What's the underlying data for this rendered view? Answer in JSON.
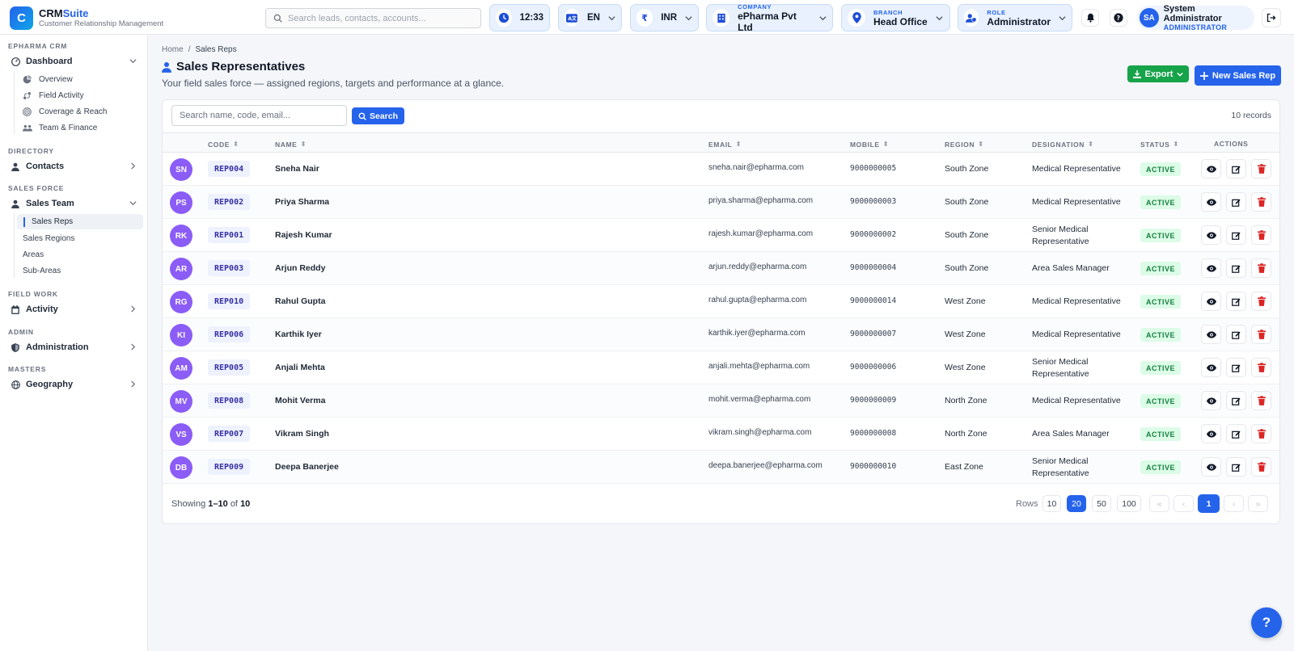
{
  "brand": {
    "logo_letter": "C",
    "name_a": "CRM",
    "name_b": "Suite",
    "subtitle": "Customer Relationship Management"
  },
  "topbar": {
    "search_placeholder": "Search leads, contacts, accounts...",
    "time": "12:33",
    "language": "EN",
    "currency_symbol": "₹",
    "currency": "INR",
    "company": {
      "label": "COMPANY",
      "value": "ePharma Pvt Ltd"
    },
    "branch": {
      "label": "BRANCH",
      "value": "Head Office"
    },
    "role": {
      "label": "ROLE",
      "value": "Administrator"
    },
    "user": {
      "initials": "SA",
      "name": "System Administrator",
      "role": "ADMINISTRATOR"
    }
  },
  "sidebar": {
    "app_section": "EPHARMA CRM",
    "dashboard": {
      "label": "Dashboard",
      "items": [
        "Overview",
        "Field Activity",
        "Coverage & Reach",
        "Team & Finance"
      ]
    },
    "directory_section": "DIRECTORY",
    "contacts": "Contacts",
    "salesforce_section": "SALES FORCE",
    "sales_team": {
      "label": "Sales Team",
      "items": [
        "Sales Reps",
        "Sales Regions",
        "Areas",
        "Sub-Areas"
      ]
    },
    "fieldwork_section": "FIELD WORK",
    "activity": "Activity",
    "admin_section": "ADMIN",
    "administration": "Administration",
    "masters_section": "MASTERS",
    "geography": "Geography"
  },
  "breadcrumb": {
    "home": "Home",
    "sep": "/",
    "current": "Sales Reps"
  },
  "page": {
    "title": "Sales Representatives",
    "subtitle": "Your field sales force — assigned regions, targets and performance at a glance.",
    "export_label": "Export",
    "new_label": "New Sales Rep"
  },
  "table": {
    "search_placeholder": "Search name, code, email...",
    "search_button": "Search",
    "records": "10 records",
    "columns": {
      "code": "CODE",
      "name": "NAME",
      "email": "EMAIL",
      "mobile": "MOBILE",
      "region": "REGION",
      "designation": "DESIGNATION",
      "status": "STATUS",
      "actions": "ACTIONS"
    },
    "rows": [
      {
        "initials": "SN",
        "code": "REP004",
        "name": "Sneha Nair",
        "email": "sneha.nair@epharma.com",
        "mobile": "9000000005",
        "region": "South Zone",
        "designation": "Medical Representative",
        "status": "ACTIVE"
      },
      {
        "initials": "PS",
        "code": "REP002",
        "name": "Priya Sharma",
        "email": "priya.sharma@epharma.com",
        "mobile": "9000000003",
        "region": "South Zone",
        "designation": "Medical Representative",
        "status": "ACTIVE"
      },
      {
        "initials": "RK",
        "code": "REP001",
        "name": "Rajesh Kumar",
        "email": "rajesh.kumar@epharma.com",
        "mobile": "9000000002",
        "region": "South Zone",
        "designation": "Senior Medical Representative",
        "status": "ACTIVE"
      },
      {
        "initials": "AR",
        "code": "REP003",
        "name": "Arjun Reddy",
        "email": "arjun.reddy@epharma.com",
        "mobile": "9000000004",
        "region": "South Zone",
        "designation": "Area Sales Manager",
        "status": "ACTIVE"
      },
      {
        "initials": "RG",
        "code": "REP010",
        "name": "Rahul Gupta",
        "email": "rahul.gupta@epharma.com",
        "mobile": "9000000014",
        "region": "West Zone",
        "designation": "Medical Representative",
        "status": "ACTIVE"
      },
      {
        "initials": "KI",
        "code": "REP006",
        "name": "Karthik Iyer",
        "email": "karthik.iyer@epharma.com",
        "mobile": "9000000007",
        "region": "West Zone",
        "designation": "Medical Representative",
        "status": "ACTIVE"
      },
      {
        "initials": "AM",
        "code": "REP005",
        "name": "Anjali Mehta",
        "email": "anjali.mehta@epharma.com",
        "mobile": "9000000006",
        "region": "West Zone",
        "designation": "Senior Medical Representative",
        "status": "ACTIVE"
      },
      {
        "initials": "MV",
        "code": "REP008",
        "name": "Mohit Verma",
        "email": "mohit.verma@epharma.com",
        "mobile": "9000000009",
        "region": "North Zone",
        "designation": "Medical Representative",
        "status": "ACTIVE"
      },
      {
        "initials": "VS",
        "code": "REP007",
        "name": "Vikram Singh",
        "email": "vikram.singh@epharma.com",
        "mobile": "9000000008",
        "region": "North Zone",
        "designation": "Area Sales Manager",
        "status": "ACTIVE"
      },
      {
        "initials": "DB",
        "code": "REP009",
        "name": "Deepa Banerjee",
        "email": "deepa.banerjee@epharma.com",
        "mobile": "9000000010",
        "region": "East Zone",
        "designation": "Senior Medical Representative",
        "status": "ACTIVE"
      }
    ]
  },
  "pagination": {
    "showing_prefix": "Showing",
    "showing_range": "1–10",
    "showing_of": "of",
    "showing_total": "10",
    "rows_label": "Rows",
    "sizes": [
      "10",
      "20",
      "50",
      "100"
    ],
    "selected_size": "20",
    "current_page": "1"
  },
  "help_label": "?",
  "colors": {
    "primary": "#2563eb",
    "export_green": "#16a34a",
    "avatar_purple": "#8b5cf6",
    "active_badge_bg": "#dcfce7",
    "active_badge_text": "#15803d",
    "delete_red": "#dc2626"
  }
}
